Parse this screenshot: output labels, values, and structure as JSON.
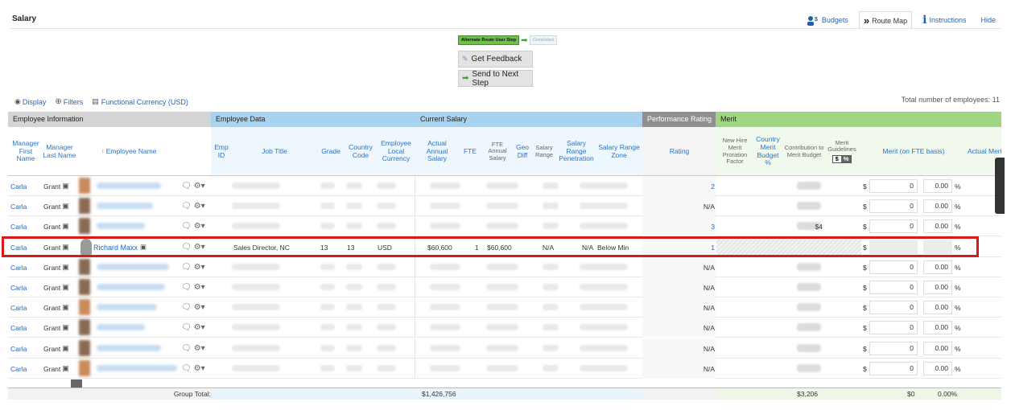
{
  "header": {
    "title": "Salary"
  },
  "toplinks": {
    "budgets": "Budgets",
    "route_map": "Route Map",
    "instructions": "Instructions",
    "hide": "Hide"
  },
  "route": {
    "step1": "Alternate Route User Step",
    "step2": "Completed"
  },
  "actions": {
    "get_feedback": "Get Feedback",
    "send_next": "Send to Next Step"
  },
  "toolbar": {
    "display": "Display",
    "filters": "Filters",
    "currency": "Functional Currency (USD)"
  },
  "summary": {
    "total_label": "Total number of employees: 11"
  },
  "groups": {
    "employee_information": "Employee Information",
    "employee_data": "Employee Data",
    "current_salary": "Current Salary",
    "performance_rating": "Performance Rating",
    "merit": "Merit"
  },
  "columns": {
    "mgr_first": "Manager First Name",
    "mgr_last": "Manager Last Name",
    "emp_name": "Employee Name",
    "emp_id": "Emp ID",
    "job_title": "Job Title",
    "grade": "Grade",
    "country_code": "Country Code",
    "local_currency": "Employee Local Currency",
    "actual_salary": "Actual Annual Salary",
    "fte": "FTE",
    "fte_salary": "FTE Annual Salary",
    "geo_diff": "Geo Diff",
    "salary_range": "Salary Range",
    "range_pen": "Salary Range Penetration",
    "range_zone": "Salary Range Zone",
    "rating": "Rating",
    "proration": "New Hire Merit Proration Factor",
    "country_budget": "Country Merit Budget %",
    "contribution": "Contribution to Merit Budget",
    "guidelines": "Merit Guidelines",
    "guide_dollar": "$",
    "guide_pct": "%",
    "merit_fte": "Merit (on FTE basis)",
    "actual_merit": "Actual Merit"
  },
  "rows": [
    {
      "mgr_first": "Carla",
      "mgr_last": "Grant",
      "rating": "2",
      "contribution": "",
      "merit_amount": "0",
      "merit_pct": "0.00"
    },
    {
      "mgr_first": "Carla",
      "mgr_last": "Grant",
      "rating": "N/A",
      "contribution": "",
      "merit_amount": "0",
      "merit_pct": "0.00"
    },
    {
      "mgr_first": "Carla",
      "mgr_last": "Grant",
      "rating": "3",
      "contribution": "$4",
      "merit_amount": "0",
      "merit_pct": "0.00"
    },
    {
      "mgr_first": "Carla",
      "mgr_last": "Grant",
      "emp_name": "Richard Maxx",
      "job_title": "Sales Director, NC",
      "grade": "13",
      "country_code": "13",
      "currency": "USD",
      "actual_salary": "$60,600",
      "fte": "1",
      "fte_salary": "$60,600",
      "salary_range": "N/A",
      "range_pen": "N/A",
      "range_zone": "Below Min",
      "rating": "1",
      "merit_amount": "",
      "merit_pct": ""
    },
    {
      "mgr_first": "Carla",
      "mgr_last": "Grant",
      "rating": "N/A",
      "merit_amount": "0",
      "merit_pct": "0.00"
    },
    {
      "mgr_first": "Carla",
      "mgr_last": "Grant",
      "rating": "N/A",
      "merit_amount": "0",
      "merit_pct": "0.00"
    },
    {
      "mgr_first": "Carla",
      "mgr_last": "Grant",
      "rating": "N/A",
      "merit_amount": "0",
      "merit_pct": "0.00"
    },
    {
      "mgr_first": "Carla",
      "mgr_last": "Grant",
      "rating": "N/A",
      "merit_amount": "0",
      "merit_pct": "0.00"
    },
    {
      "mgr_first": "Carla",
      "mgr_last": "Grant",
      "rating": "N/A",
      "merit_amount": "0",
      "merit_pct": "0.00"
    },
    {
      "mgr_first": "Carla",
      "mgr_last": "Grant",
      "rating": "N/A",
      "merit_amount": "0",
      "merit_pct": "0.00"
    }
  ],
  "footer": {
    "label": "Group Total:",
    "actual_salary": "$1,426,756",
    "contribution": "$3,206",
    "merit_amount": "$0",
    "merit_pct": "0.00%"
  },
  "symbols": {
    "dollar": "$",
    "pct": "%"
  },
  "colors": {
    "group_gray": "#d4d4d4",
    "group_blue": "#a8d3f0",
    "group_perf": "#8f8f8f",
    "group_green": "#9fd681",
    "highlight": "#d71a1a",
    "link": "#1a66c4"
  }
}
